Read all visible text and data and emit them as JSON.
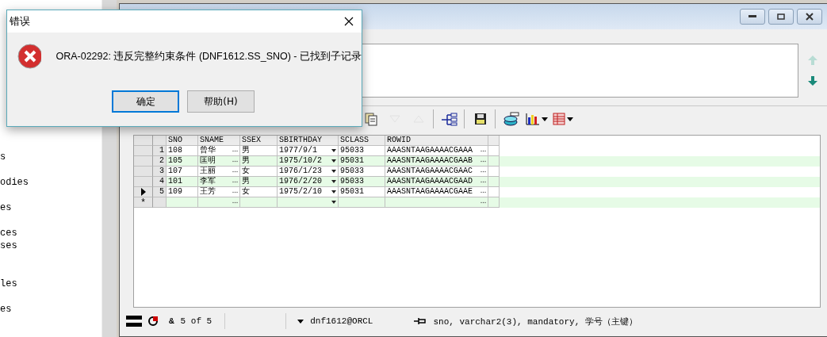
{
  "tree_panel": {
    "items": [
      "s",
      "odies",
      "es",
      "ces",
      "ses",
      "les",
      "es"
    ]
  },
  "editor": {
    "previous_disabled": true,
    "next_disabled": false
  },
  "toolbar": {
    "right": [
      {
        "kind": "documents",
        "disabled": false,
        "separator_before": false,
        "menu": false
      },
      {
        "kind": "down",
        "disabled": true,
        "separator_before": false,
        "menu": false
      },
      {
        "kind": "up",
        "disabled": true,
        "separator_before": false,
        "menu": false
      },
      {
        "kind": "tree",
        "disabled": false,
        "separator_before": true,
        "menu": false
      },
      {
        "kind": "save",
        "disabled": false,
        "separator_before": true,
        "menu": false
      },
      {
        "kind": "database",
        "disabled": false,
        "separator_before": true,
        "menu": false
      },
      {
        "kind": "chart",
        "disabled": false,
        "separator_before": false,
        "menu": true
      },
      {
        "kind": "table",
        "disabled": false,
        "separator_before": false,
        "menu": true
      }
    ]
  },
  "grid": {
    "columns": [
      {
        "name": "SNO",
        "kind": "plain"
      },
      {
        "name": "SNAME",
        "kind": "lookup"
      },
      {
        "name": "SSEX",
        "kind": "plain"
      },
      {
        "name": "SBIRTHDAY",
        "kind": "dropdown"
      },
      {
        "name": "SCLASS",
        "kind": "plain"
      },
      {
        "name": "ROWID",
        "kind": "lookup"
      }
    ],
    "rows": [
      {
        "number": "1",
        "current": false,
        "cells": [
          "108",
          "曾华",
          "男",
          "1977/9/1",
          "95033",
          "AAASNTAAGAAAACGAAA"
        ]
      },
      {
        "number": "2",
        "current": false,
        "cells": [
          "105",
          "匡明",
          "男",
          "1975/10/2",
          "95031",
          "AAASNTAAGAAAACGAAB"
        ]
      },
      {
        "number": "3",
        "current": false,
        "cells": [
          "107",
          "王丽",
          "女",
          "1976/1/23",
          "95033",
          "AAASNTAAGAAAACGAAC"
        ]
      },
      {
        "number": "4",
        "current": false,
        "cells": [
          "101",
          "李军",
          "男",
          "1976/2/20",
          "95033",
          "AAASNTAAGAAAACGAAD"
        ]
      },
      {
        "number": "5",
        "current": true,
        "cells": [
          "109",
          "王芳",
          "女",
          "1975/2/10",
          "95031",
          "AAASNTAAGAAAACGAAE"
        ]
      }
    ],
    "new_row_marker": "*"
  },
  "status_bar": {
    "symbol": "&",
    "record": "5 of 5",
    "connection": "dnf1612@ORCL",
    "field_info": "sno, varchar2(3), mandatory, 学号（主键）"
  },
  "dialog": {
    "title": "错误",
    "message": "ORA-02292: 违反完整约束条件 (DNF1612.SS_SNO) - 已找到子记录",
    "buttons": [
      {
        "label": "确定",
        "focused": true
      },
      {
        "label": "帮助(H)",
        "focused": false
      }
    ]
  }
}
